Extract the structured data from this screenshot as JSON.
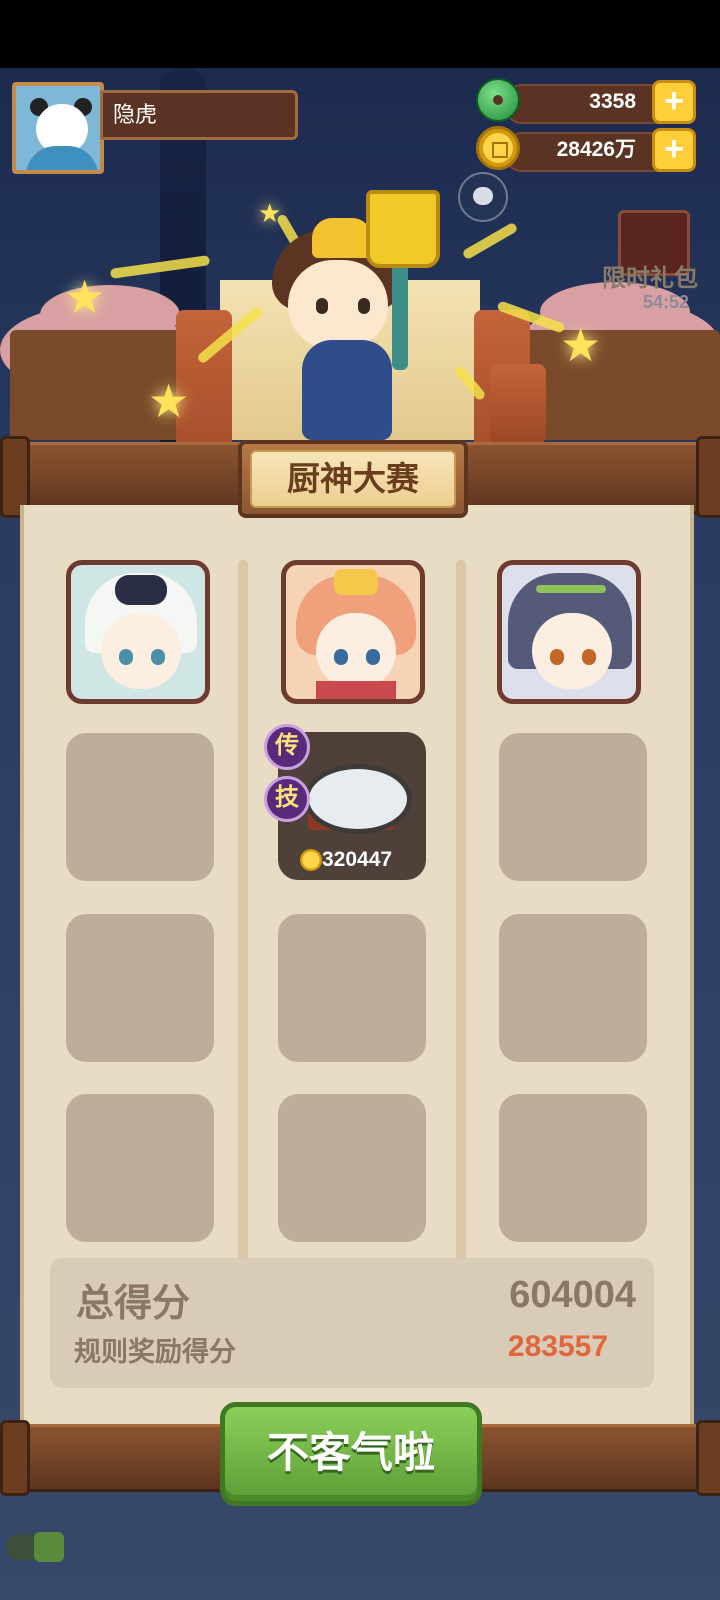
{
  "player": {
    "name": "隐虎"
  },
  "currency": {
    "jade": "3358",
    "coins": "28426万"
  },
  "gift_pack": {
    "label": "限时礼包",
    "timer": "54:52"
  },
  "event_title": "厨神大赛",
  "dish": {
    "badge_1": "传",
    "badge_2": "技",
    "score": "320447"
  },
  "scores": {
    "total_label": "总得分",
    "total_value": "604004",
    "bonus_label": "规则奖励得分",
    "bonus_value": "283557"
  },
  "confirm_button": "不客气啦",
  "colors": {
    "accent_green": "#6fb446",
    "bonus_orange": "#e0663c",
    "panel_bg": "#e8dcc4"
  }
}
